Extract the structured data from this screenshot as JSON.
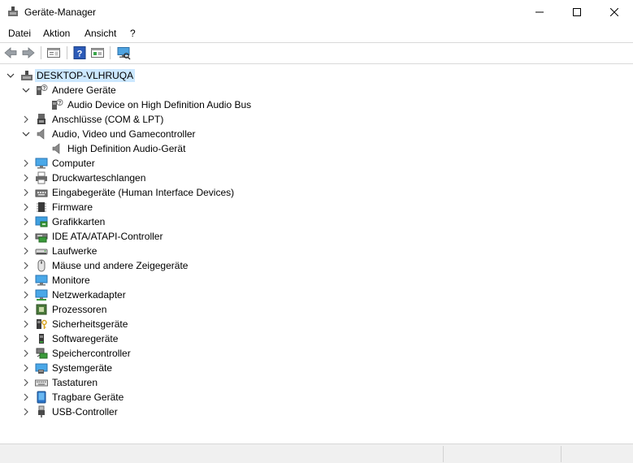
{
  "window": {
    "title": "Geräte-Manager"
  },
  "menu": {
    "items": [
      "Datei",
      "Aktion",
      "Ansicht",
      "?"
    ]
  },
  "tree": {
    "root": "DESKTOP-VLHRUQA",
    "nodes": [
      {
        "label": "Andere Geräte",
        "expanded": true,
        "icon": "unknown-device-icon"
      },
      {
        "label": "Audio Device on High Definition Audio Bus",
        "child": true,
        "icon": "unknown-device-icon"
      },
      {
        "label": "Anschlüsse (COM & LPT)",
        "icon": "port-icon"
      },
      {
        "label": "Audio, Video und Gamecontroller",
        "expanded": true,
        "icon": "speaker-icon"
      },
      {
        "label": "High Definition Audio-Gerät",
        "child": true,
        "icon": "speaker-icon"
      },
      {
        "label": "Computer",
        "icon": "computer-icon"
      },
      {
        "label": "Druckwarteschlangen",
        "icon": "printer-icon"
      },
      {
        "label": "Eingabegeräte (Human Interface Devices)",
        "icon": "hid-icon"
      },
      {
        "label": "Firmware",
        "icon": "firmware-icon"
      },
      {
        "label": "Grafikkarten",
        "icon": "display-adapter-icon"
      },
      {
        "label": "IDE ATA/ATAPI-Controller",
        "icon": "ide-controller-icon"
      },
      {
        "label": "Laufwerke",
        "icon": "disk-drive-icon"
      },
      {
        "label": "Mäuse und andere Zeigegeräte",
        "icon": "mouse-icon"
      },
      {
        "label": "Monitore",
        "icon": "monitor-icon"
      },
      {
        "label": "Netzwerkadapter",
        "icon": "network-adapter-icon"
      },
      {
        "label": "Prozessoren",
        "icon": "processor-icon"
      },
      {
        "label": "Sicherheitsgeräte",
        "icon": "security-device-icon"
      },
      {
        "label": "Softwaregeräte",
        "icon": "software-device-icon"
      },
      {
        "label": "Speichercontroller",
        "icon": "storage-controller-icon"
      },
      {
        "label": "Systemgeräte",
        "icon": "system-device-icon"
      },
      {
        "label": "Tastaturen",
        "icon": "keyboard-icon"
      },
      {
        "label": "Tragbare Geräte",
        "icon": "portable-device-icon"
      },
      {
        "label": "USB-Controller",
        "icon": "usb-icon"
      }
    ]
  },
  "colors": {
    "selection": "#cce8ff",
    "accent": "#0078d7"
  }
}
